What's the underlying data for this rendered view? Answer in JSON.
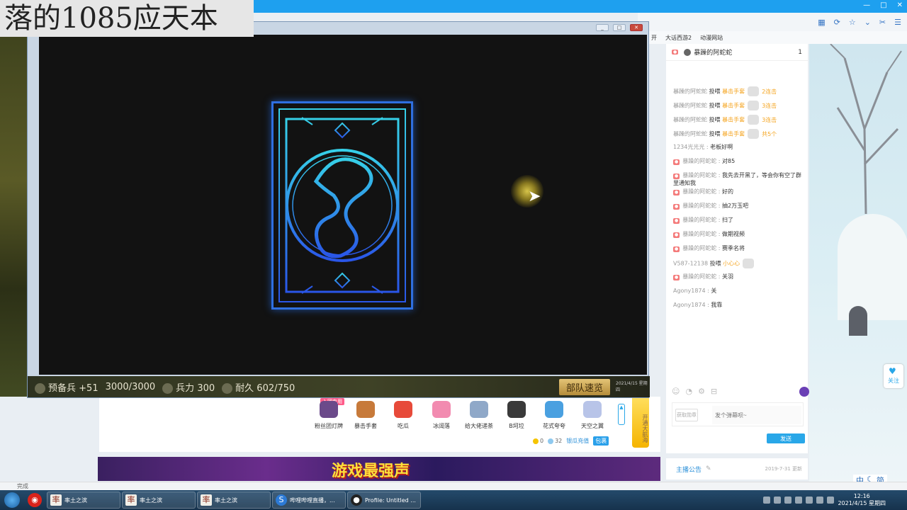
{
  "overlay_title": "落的1085应天本",
  "browser": {
    "bookmarks": [
      "开",
      "大话西游2",
      "动漫网站"
    ]
  },
  "game": {
    "hud": {
      "reserve_label": "预备兵",
      "reserve_delta": "+51",
      "reserve_value": "3000/3000",
      "troops_label": "兵力",
      "troops_value": "300",
      "durability_label": "耐久",
      "durability_value": "602/750",
      "deploy_button": "部队速览",
      "timestamp": "2021/4/15 星期四"
    }
  },
  "gift_bar": {
    "badge": "入团专用",
    "gifts": [
      {
        "label": "粉丝团灯牌",
        "color": "#6b4a8a"
      },
      {
        "label": "暴击手套",
        "color": "#c77a3a"
      },
      {
        "label": "吃瓜",
        "color": "#e74a3a"
      },
      {
        "label": "冰阔落",
        "color": "#f28bb0"
      },
      {
        "label": "给大佬递茶",
        "color": "#8fa8c8"
      },
      {
        "label": "B坷垃",
        "color": "#3a3a3a"
      },
      {
        "label": "花式夸夸",
        "color": "#4aa0e0"
      },
      {
        "label": "天空之翼",
        "color": "#b8c4e8"
      }
    ],
    "vip_label": "开通大航海",
    "scroll_arrow": "▲",
    "balance": {
      "gold": "0",
      "silver": "32",
      "recharge": "银瓜充值",
      "package": "包裹"
    }
  },
  "ad_banner": {
    "text": "游戏最强声"
  },
  "chat": {
    "top_user": "暴躁的阿蛇蛇",
    "top_rank": "1",
    "messages": [
      {
        "user": "暴躁的阿蛇蛇",
        "action": "投喂",
        "gift": "暴击手套",
        "combo": "2连击",
        "lvl": false
      },
      {
        "user": "暴躁的阿蛇蛇",
        "action": "投喂",
        "gift": "暴击手套",
        "combo": "3连击",
        "lvl": false
      },
      {
        "user": "暴躁的阿蛇蛇",
        "action": "投喂",
        "gift": "暴击手套",
        "combo": "3连击",
        "lvl": false
      },
      {
        "user": "暴躁的阿蛇蛇",
        "action": "投喂",
        "gift": "暴击手套",
        "combo": "共5个",
        "lvl": false
      },
      {
        "user": "1234光光光",
        "text": "老板好啊",
        "lvl": false
      },
      {
        "user": "暴躁的阿蛇蛇",
        "text": "对85",
        "lvl": true
      },
      {
        "user": "暴躁的阿蛇蛇",
        "text": "我先去开黑了，等会你有空了群里通知我",
        "lvl": true
      },
      {
        "user": "暴躁的阿蛇蛇",
        "text": "好的",
        "lvl": true
      },
      {
        "user": "暴躁的阿蛇蛇",
        "text": "抽2万玉吧",
        "lvl": true
      },
      {
        "user": "暴躁的阿蛇蛇",
        "text": "扫了",
        "lvl": true
      },
      {
        "user": "暴躁的阿蛇蛇",
        "text": "做期视频",
        "lvl": true
      },
      {
        "user": "暴躁的阿蛇蛇",
        "text": "赛季名将",
        "lvl": true
      },
      {
        "user": "V587-12138",
        "action": "投喂",
        "gift": "小心心",
        "combo": "",
        "lvl": false
      },
      {
        "user": "暴躁的阿蛇蛇",
        "text": "关羽",
        "lvl": true
      },
      {
        "user": "Agony1874",
        "text": "关",
        "lvl": false
      },
      {
        "user": "Agony1874",
        "text": "我靠",
        "lvl": false
      }
    ],
    "badge_button": "获取勋章",
    "input_placeholder": "发个弹幕呗~",
    "send_button": "发送",
    "announcement_label": "主播公告",
    "announcement_date": "2019-7-31 更新"
  },
  "side": {
    "follow_label": "关注",
    "ime": [
      "中",
      "简"
    ]
  },
  "statusbar": {
    "text": "完成"
  },
  "taskbar": {
    "tasks": [
      {
        "label": "率土之滨",
        "icon": "率",
        "style": ""
      },
      {
        "label": "率土之滨",
        "icon": "率",
        "style": ""
      },
      {
        "label": "率土之滨",
        "icon": "率",
        "style": ""
      },
      {
        "label": "哔哩哔哩直播，...",
        "icon": "S",
        "style": "blue"
      },
      {
        "label": "Profile: Untitled ...",
        "icon": "●",
        "style": "dark"
      }
    ],
    "time": "12:16",
    "date": "2021/4/15 星期四"
  }
}
